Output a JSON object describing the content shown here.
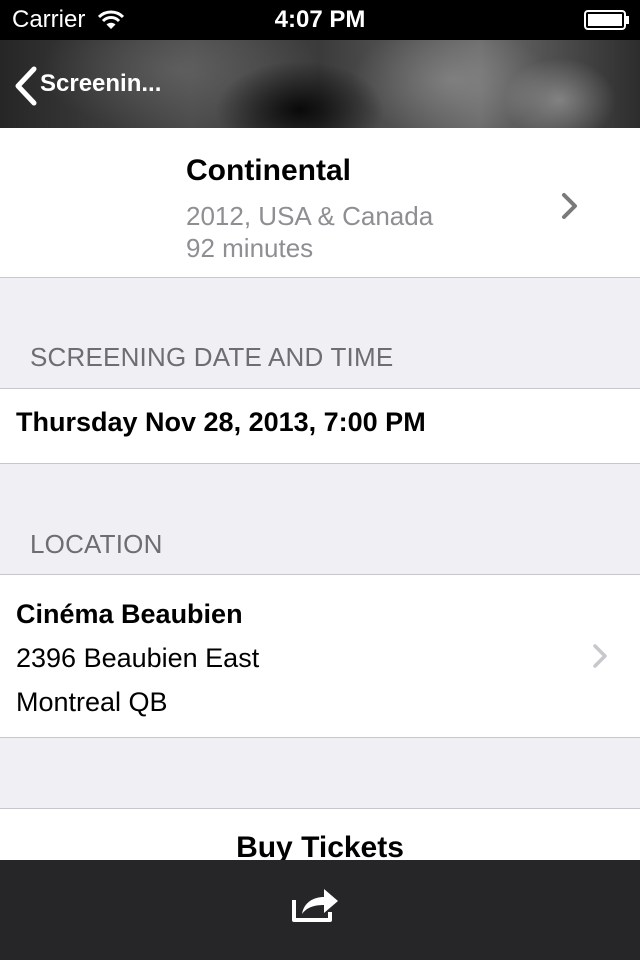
{
  "status_bar": {
    "carrier": "Carrier",
    "time": "4:07 PM"
  },
  "nav": {
    "back_label": "Screenin..."
  },
  "movie": {
    "title": "Continental",
    "meta_line1": "2012, USA & Canada",
    "meta_line2": "92 minutes"
  },
  "sections": {
    "date_header": "SCREENING DATE AND TIME",
    "location_header": "LOCATION"
  },
  "screening": {
    "datetime": "Thursday Nov 28, 2013, 7:00 PM"
  },
  "location": {
    "name": "Cinéma Beaubien",
    "address_line1": "2396 Beaubien East",
    "address_line2": "Montreal QB"
  },
  "actions": {
    "buy_tickets": "Buy Tickets"
  },
  "icons": {
    "wifi": "wifi-icon",
    "battery": "battery-icon",
    "back": "chevron-left-icon",
    "disclosure": "chevron-right-icon",
    "share": "share-icon"
  },
  "colors": {
    "secondary_text": "#8e8e93",
    "section_header": "#6d6d72",
    "toolbar": "#262628"
  }
}
